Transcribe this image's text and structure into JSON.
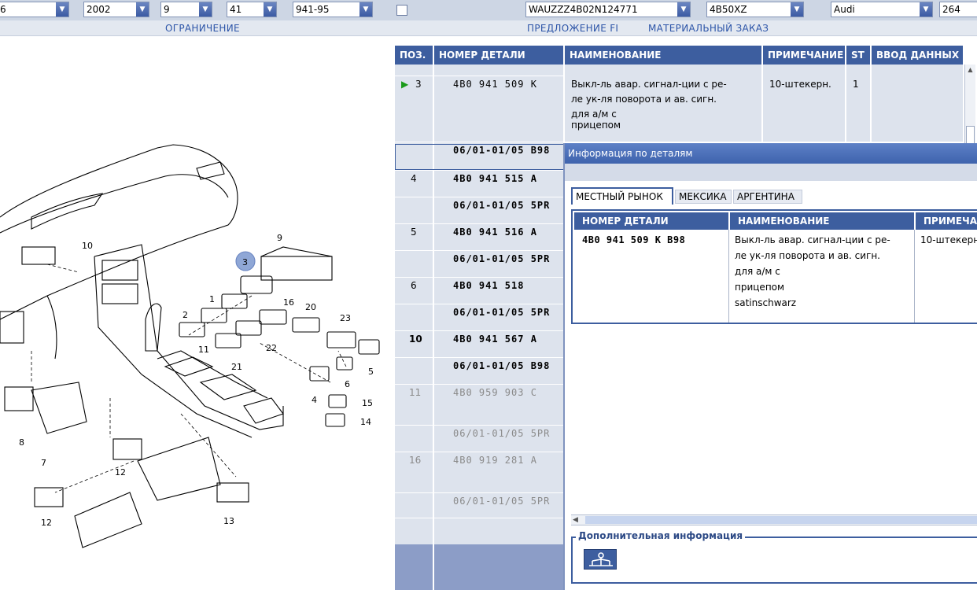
{
  "topbar": {
    "combos": [
      {
        "value": "6"
      },
      {
        "value": "2002"
      },
      {
        "value": "9"
      },
      {
        "value": "41"
      },
      {
        "value": "941-95"
      },
      {
        "value": "WAUZZZ4B02N124771"
      },
      {
        "value": "4B50XZ"
      },
      {
        "value": "Audi"
      },
      {
        "value": "264"
      }
    ]
  },
  "subbar": {
    "restriction": "ОГРАНИЧЕНИЕ",
    "offer": "ПРЕДЛОЖЕНИЕ FI",
    "material_order": "МАТЕРИАЛЬНЫЙ ЗАКАЗ"
  },
  "diagram": {
    "callouts": [
      "10",
      "9",
      "3",
      "16",
      "1",
      "2",
      "20",
      "23",
      "11",
      "22",
      "21",
      "5",
      "6",
      "4",
      "15",
      "14",
      "8",
      "7",
      "12",
      "12",
      "13"
    ]
  },
  "parts_table": {
    "headers": {
      "pos": "ПОЗ.",
      "part_no": "НОМЕР ДЕТАЛИ",
      "name": "НАИМЕНОВАНИЕ",
      "note": "ПРИМЕЧАНИЕ",
      "st": "ST",
      "input": "ВВОД ДАННЫХ ПО"
    },
    "rows": [
      {
        "pos": "3",
        "part": "4B0 941 509 K",
        "name_lines": [
          "Выкл-ль авар. сигнал-ции с ре-",
          "ле ук-ля поворота и ав. сигн.",
          "для а/м с",
          "прицепом"
        ],
        "note": "10-штекерн.",
        "st": "1",
        "date": "06/01-01/05 B98"
      },
      {
        "pos": "4",
        "part": "4B0 941 515 A",
        "date": "06/01-01/05 5PR"
      },
      {
        "pos": "5",
        "part": "4B0 941 516 A",
        "date": "06/01-01/05 5PR"
      },
      {
        "pos": "6",
        "part": "4B0 941 518",
        "date": "06/01-01/05 5PR"
      },
      {
        "pos": "10",
        "part": "4B0 941 567 A",
        "date": "06/01-01/05 B98"
      },
      {
        "pos": "11",
        "part": "4B0 959 903 C",
        "date": "06/01-01/05 5PR"
      },
      {
        "pos": "16",
        "part": "4B0 919 281 A",
        "date": "06/01-01/05 5PR"
      }
    ]
  },
  "dialog": {
    "title": "Информация по деталям",
    "tabs": [
      "МЕСТНЫЙ РЫНОК",
      "МЕКСИКА",
      "АРГЕНТИНА"
    ],
    "headers": {
      "part_no": "НОМЕР ДЕТАЛИ",
      "name": "НАИМЕНОВАНИЕ",
      "note": "ПРИМЕЧАН"
    },
    "row": {
      "part": "4B0 941 509 K  B98",
      "name_lines": [
        "Выкл-ль авар. сигнал-ции с ре-",
        "ле ук-ля поворота и ав. сигн.",
        "для а/м с",
        "прицепом",
        "satinschwarz"
      ],
      "note": "10-штекерн."
    },
    "additional_info": "Дополнительная информация"
  },
  "colors": {
    "header_blue": "#3d5e9f",
    "title_blue": "#4a6fb8",
    "row_bg": "#dde3ed",
    "topbar_bg": "#cdd6e4"
  }
}
